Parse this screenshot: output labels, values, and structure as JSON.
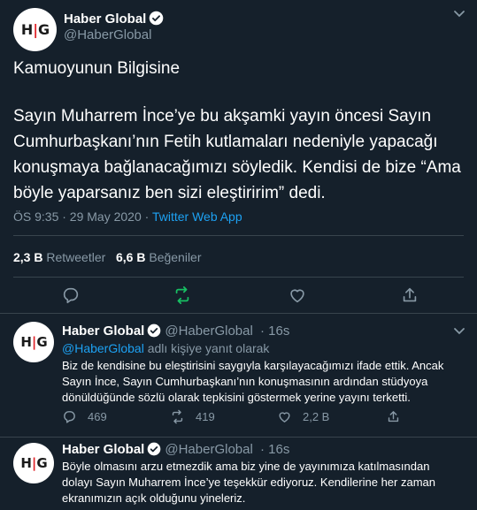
{
  "main_tweet": {
    "display_name": "Haber Global",
    "handle": "@HaberGlobal",
    "heading": "Kamuoyunun Bilgisine",
    "text": "Sayın Muharrem İnce’ye bu akşamki yayın öncesi Sayın Cumhurbaşkanı’nın Fetih kutlamaları nedeniyle yapacağı konuşmaya bağlanacağımızı söyledik. Kendisi de bize “Ama böyle yaparsanız ben sizi eleştiririm” dedi.",
    "timestamp": "ÖS 9:35 · 29 May 2020 · ",
    "source": "Twitter Web App",
    "retweets_count": "2,3 B",
    "retweets_label": " Retweetler",
    "likes_count": "6,6 B",
    "likes_label": " Beğeniler"
  },
  "avatar": {
    "left": "H",
    "bar": "|",
    "right": "G"
  },
  "replies": [
    {
      "display_name": "Haber Global",
      "handle": "@HaberGlobal",
      "time": "16s",
      "replying_mention": "@HaberGlobal",
      "replying_suffix": " adlı kişiye yanıt olarak",
      "text": "Biz de kendisine bu eleştirisini saygıyla karşılayacağımızı ifade ettik. Ancak Sayın İnce, Sayın Cumhurbaşkanı’nın konuşmasının ardından stüdyoya dönüldüğünde sözlü olarak tepkisini göstermek yerine yayını terketti.",
      "reply_count": "469",
      "retweet_count": "419",
      "like_count": "2,2 B"
    },
    {
      "display_name": "Haber Global",
      "handle": "@HaberGlobal",
      "time": "16s",
      "text": "Böyle olmasını arzu etmezdik ama biz yine de yayınımıza katılmasından dolayı Sayın Muharrem İnce’ye teşekkür ediyoruz. Kendilerine her zaman ekranımızın açık olduğunu yineleriz."
    }
  ],
  "colors": {
    "background": "#15202b",
    "accent": "#1da1f2",
    "retweet_green": "#17bf63",
    "muted": "#8899a6",
    "divider": "#38444d"
  }
}
